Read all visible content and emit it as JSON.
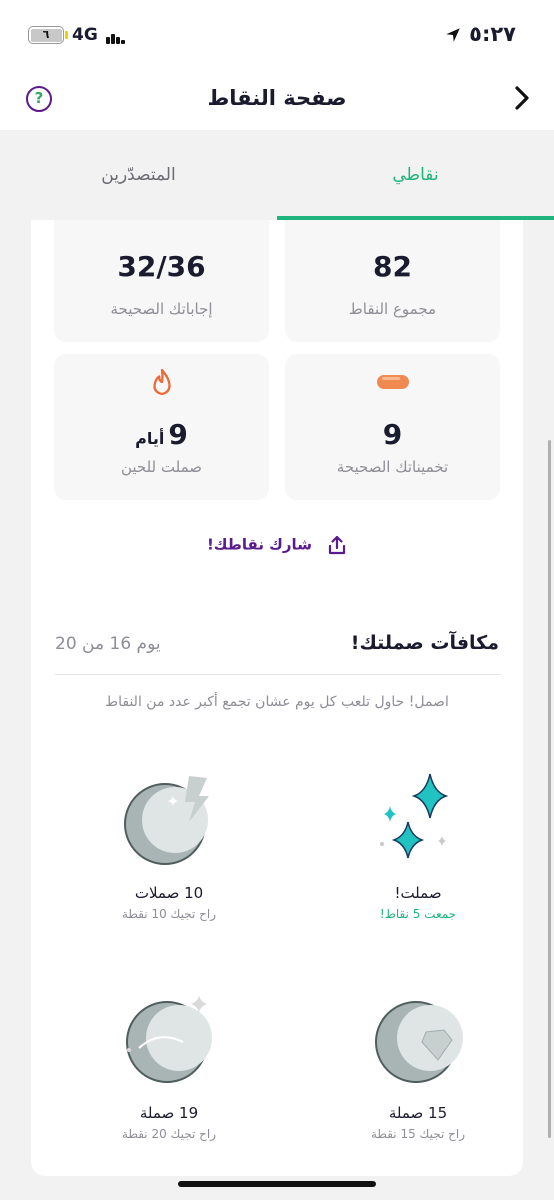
{
  "status": {
    "time": "٥:٢٧",
    "network": "4G",
    "battery": "٦"
  },
  "header": {
    "title": "صفحة النقاط",
    "help": "?"
  },
  "tabs": {
    "points": "نقاطي",
    "leaders": "المتصدّرين"
  },
  "stats": {
    "total_points": {
      "value": "82",
      "label": "مجموع النقاط"
    },
    "correct_answers": {
      "value": "32/36",
      "label": "إجاباتك الصحيحة"
    },
    "correct_guesses": {
      "value": "9",
      "label": "تخميناتك الصحيحة"
    },
    "streak": {
      "value": "9",
      "unit": "أيام",
      "label": "صملت للحين"
    }
  },
  "share_label": "شارك نقاطك!",
  "rewards": {
    "title": "مكافآت صملتك!",
    "progress": "يوم 16 من 20",
    "hint": "اصمل! حاول تلعب كل يوم عشان تجمع أكبر عدد من النقاط",
    "badges": [
      {
        "title": "صملت!",
        "sub": "جمعت 5 نقاط!"
      },
      {
        "title": "10 صملات",
        "sub": "راح تجيك 10 نقطة"
      },
      {
        "title": "15 صملة",
        "sub": "راح تجيك 15 نقطة"
      },
      {
        "title": "19 صملة",
        "sub": "راح تجيك 20 نقطة"
      }
    ]
  },
  "colors": {
    "accent": "#1fb57e",
    "purple": "#5b1a8e",
    "fire": "#ea6b3a",
    "pill": "#f08a52",
    "sparkle": "#20c2c2"
  }
}
